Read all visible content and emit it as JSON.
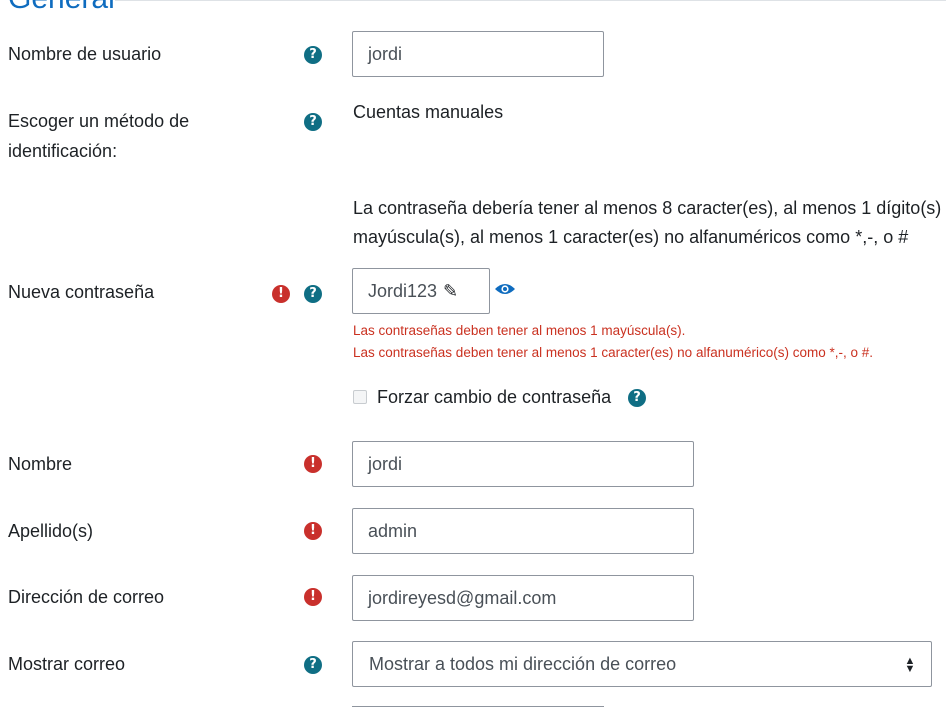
{
  "section_title": "General",
  "fields": {
    "username": {
      "label": "Nombre de usuario",
      "value": "jordi"
    },
    "auth": {
      "label_line1": "Escoger un método de",
      "label_line2": "identificación:",
      "value": "Cuentas manuales"
    },
    "password_policy": {
      "line1": "La contraseña debería tener al menos 8 caracter(es), al menos 1 dígito(s)",
      "line2": "mayúscula(s), al menos 1 caracter(es) no alfanuméricos como *,-, o #"
    },
    "new_password": {
      "label": "Nueva contraseña",
      "value": "Jordi123",
      "errors": [
        "Las contraseñas deben tener al menos 1 mayúscula(s).",
        "Las contraseñas deben tener al menos 1 caracter(es) no alfanumérico(s) como *,-, o #."
      ]
    },
    "force_change": {
      "label": "Forzar cambio de contraseña",
      "checked": false
    },
    "firstname": {
      "label": "Nombre",
      "value": "jordi"
    },
    "lastname": {
      "label": "Apellido(s)",
      "value": "admin"
    },
    "email": {
      "label": "Dirección de correo",
      "value": "jordireyesd@gmail.com"
    },
    "show_email": {
      "label": "Mostrar correo",
      "selected": "Mostrar a todos mi dirección de correo"
    }
  },
  "icons": {
    "help_glyph": "?",
    "error_glyph": "!",
    "pencil_glyph": "✎"
  },
  "colors": {
    "help": "#0f6e84",
    "error": "#c9302c",
    "link": "#0f6cbf"
  }
}
